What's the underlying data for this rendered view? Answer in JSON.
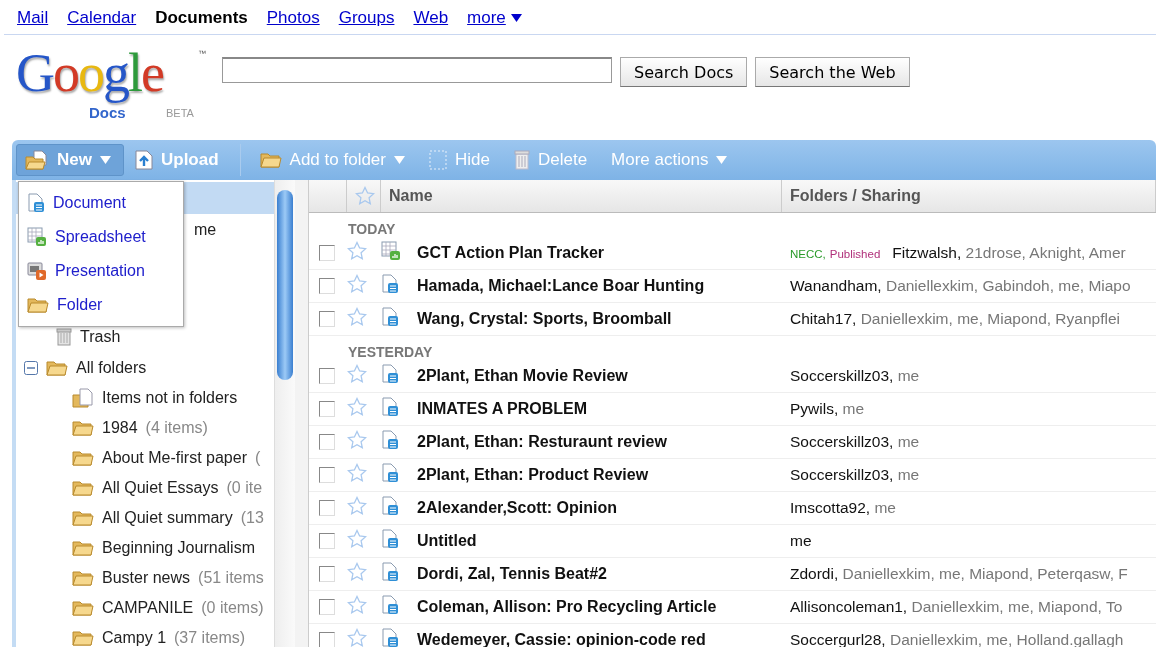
{
  "nav": {
    "links": [
      {
        "label": "Mail",
        "selected": false
      },
      {
        "label": "Calendar",
        "selected": false
      },
      {
        "label": "Documents",
        "selected": true
      },
      {
        "label": "Photos",
        "selected": false
      },
      {
        "label": "Groups",
        "selected": false
      },
      {
        "label": "Web",
        "selected": false
      },
      {
        "label": "more",
        "selected": false,
        "menu": true
      }
    ]
  },
  "logo": {
    "wordmark": "Google",
    "mark": "™",
    "product": "Docs",
    "badge": "BETA"
  },
  "search": {
    "buttons": [
      "Search Docs",
      "Search the Web"
    ]
  },
  "toolbar": {
    "groups": [
      [
        {
          "label": "New",
          "kind": "new",
          "menu": true,
          "pressed": true
        },
        {
          "label": "Upload",
          "kind": "upload",
          "menu": false,
          "pressed": false
        }
      ],
      [
        {
          "label": "Add to folder",
          "kind": "folder",
          "menu": true,
          "pressed": false
        },
        {
          "label": "Hide",
          "kind": "hide",
          "menu": false,
          "pressed": false
        },
        {
          "label": "Delete",
          "kind": "delete",
          "menu": false,
          "pressed": false
        },
        {
          "label": "More actions",
          "kind": "text",
          "menu": true,
          "pressed": false
        }
      ]
    ]
  },
  "new_menu": {
    "items": [
      {
        "label": "Document",
        "kind": "document"
      },
      {
        "label": "Spreadsheet",
        "kind": "spreadsheet"
      },
      {
        "label": "Presentation",
        "kind": "presentation"
      },
      {
        "label": "Folder",
        "kind": "folder"
      }
    ]
  },
  "sidebar": {
    "items": [
      {
        "selected": true
      },
      {
        "label": "me",
        "selected": false
      },
      {
        "label": "Trash",
        "kind": "trash",
        "selected": false
      }
    ],
    "folders": {
      "label": "All folders",
      "expanded": true,
      "children": [
        {
          "label": "Items not in folders",
          "kind": "unfiled"
        },
        {
          "label": "1984",
          "count": "(4 items)",
          "kind": "folder"
        },
        {
          "label": "About Me-first paper",
          "count": "(",
          "kind": "folder"
        },
        {
          "label": "All Quiet Essays",
          "count": "(0 ite",
          "kind": "folder"
        },
        {
          "label": "All Quiet summary",
          "count": "(13",
          "kind": "folder"
        },
        {
          "label": "Beginning Journalism",
          "kind": "folder"
        },
        {
          "label": "Buster news",
          "count": "(51 items",
          "kind": "folder"
        },
        {
          "label": "CAMPANILE",
          "count": "(0 items)",
          "kind": "folder"
        },
        {
          "label": "Campy 1",
          "count": "(37 items)",
          "kind": "folder"
        }
      ]
    }
  },
  "table": {
    "columns": [
      "Name",
      "Folders / Sharing"
    ],
    "groups": [
      {
        "label": "TODAY",
        "rows": [
          {
            "kind": "spreadsheet",
            "checked": false,
            "starred": false,
            "name": "GCT Action Plan Tracker",
            "tags": [
              {
                "label": "NECC,",
                "color": "#2a9a2a"
              },
              {
                "label": "Published",
                "color": "#b0307a"
              }
            ],
            "owner": "Fitzwalsh,",
            "others": "21drose, Aknight, Amer"
          },
          {
            "kind": "document",
            "checked": false,
            "starred": false,
            "name": "Hamada, Michael:Lance Boar Hunting",
            "owner": "Wanandham,",
            "others": "Daniellexkim, Gabindoh, me, Miapo"
          },
          {
            "kind": "document",
            "checked": false,
            "starred": false,
            "name": "Wang, Crystal: Sports, Broomball",
            "owner": "Chitah17,",
            "others": "Daniellexkim, me, Miapond, Ryanpflei"
          }
        ]
      },
      {
        "label": "YESTERDAY",
        "rows": [
          {
            "kind": "document",
            "checked": false,
            "starred": false,
            "name": "2Plant, Ethan Movie Review",
            "owner": "Soccerskillz03,",
            "others": "me"
          },
          {
            "kind": "document",
            "checked": false,
            "starred": false,
            "name": "INMATES A PROBLEM",
            "owner": "Pywils,",
            "others": "me"
          },
          {
            "kind": "document",
            "checked": false,
            "starred": false,
            "name": "2Plant, Ethan: Resturaunt review",
            "owner": "Soccerskillz03,",
            "others": "me"
          },
          {
            "kind": "document",
            "checked": false,
            "starred": false,
            "name": "2Plant, Ethan: Product Review",
            "owner": "Soccerskillz03,",
            "others": "me"
          },
          {
            "kind": "document",
            "checked": false,
            "starred": false,
            "name": "2Alexander,Scott: Opinion",
            "owner": "Imscotta92,",
            "others": "me"
          },
          {
            "kind": "document",
            "checked": false,
            "starred": false,
            "name": "Untitled",
            "owner": "me"
          },
          {
            "kind": "document",
            "checked": false,
            "starred": false,
            "name": "Dordi, Zal, Tennis Beat#2",
            "owner": "Zdordi,",
            "others": "Daniellexkim, me, Miapond, Peterqasw, F"
          },
          {
            "kind": "document",
            "checked": false,
            "starred": false,
            "name": "Coleman, Allison: Pro Recycling Article",
            "owner": "Allisoncoleman1,",
            "others": "Daniellexkim, me, Miapond, To"
          },
          {
            "kind": "document",
            "checked": false,
            "starred": false,
            "name": "Wedemeyer, Cassie: opinion-code red",
            "owner": "Soccergurl28,",
            "others": "Daniellexkim, me, Holland.gallagh"
          }
        ]
      }
    ]
  }
}
